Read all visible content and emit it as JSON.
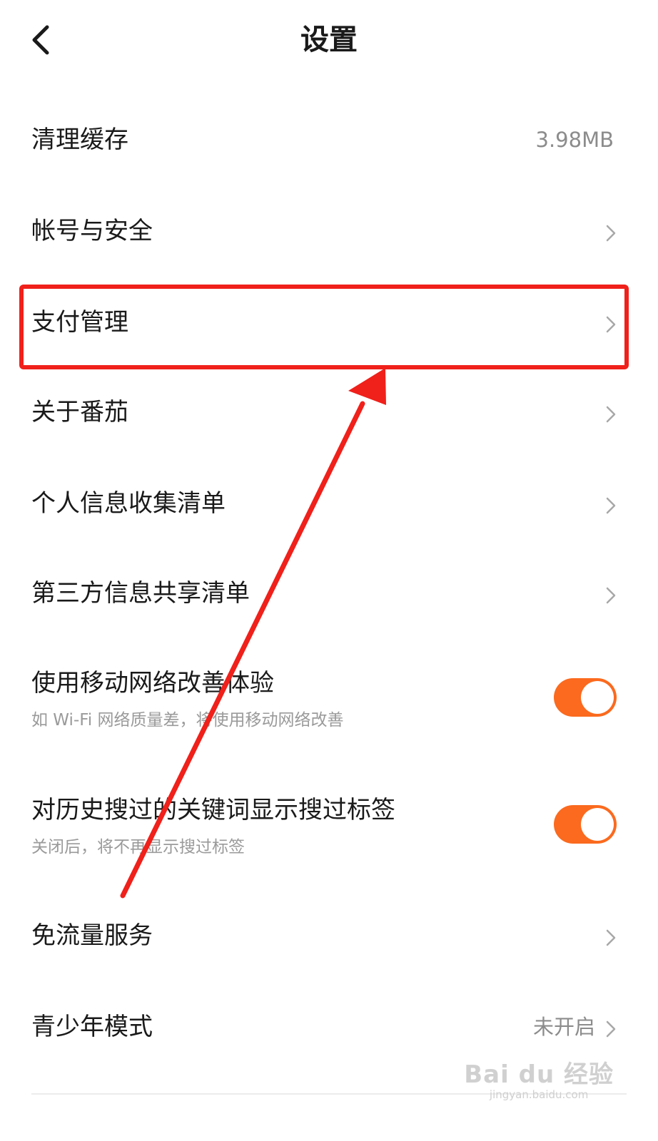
{
  "header": {
    "title": "设置"
  },
  "settings": {
    "clear_cache": {
      "label": "清理缓存",
      "value": "3.98MB"
    },
    "account_security": {
      "label": "帐号与安全"
    },
    "payment_management": {
      "label": "支付管理"
    },
    "about": {
      "label": "关于番茄"
    },
    "personal_info_list": {
      "label": "个人信息收集清单"
    },
    "third_party_sharing_list": {
      "label": "第三方信息共享清单"
    },
    "mobile_network_boost": {
      "label": "使用移动网络改善体验",
      "description": "如 Wi-Fi 网络质量差，将使用移动网络改善",
      "enabled": true
    },
    "search_history_tags": {
      "label": "对历史搜过的关键词显示搜过标签",
      "description": "关闭后，将不再显示搜过标签",
      "enabled": true
    },
    "data_free_service": {
      "label": "免流量服务"
    },
    "teen_mode": {
      "label": "青少年模式",
      "value": "未开启"
    }
  },
  "annotation": {
    "highlight_color": "#f0201a",
    "target": "支付管理"
  },
  "colors": {
    "accent": "#fb6a1e",
    "secondary_text": "#9a9a9a"
  },
  "watermark": {
    "logo_text": "Bai du 经验",
    "url": "jingyan.baidu.com"
  }
}
